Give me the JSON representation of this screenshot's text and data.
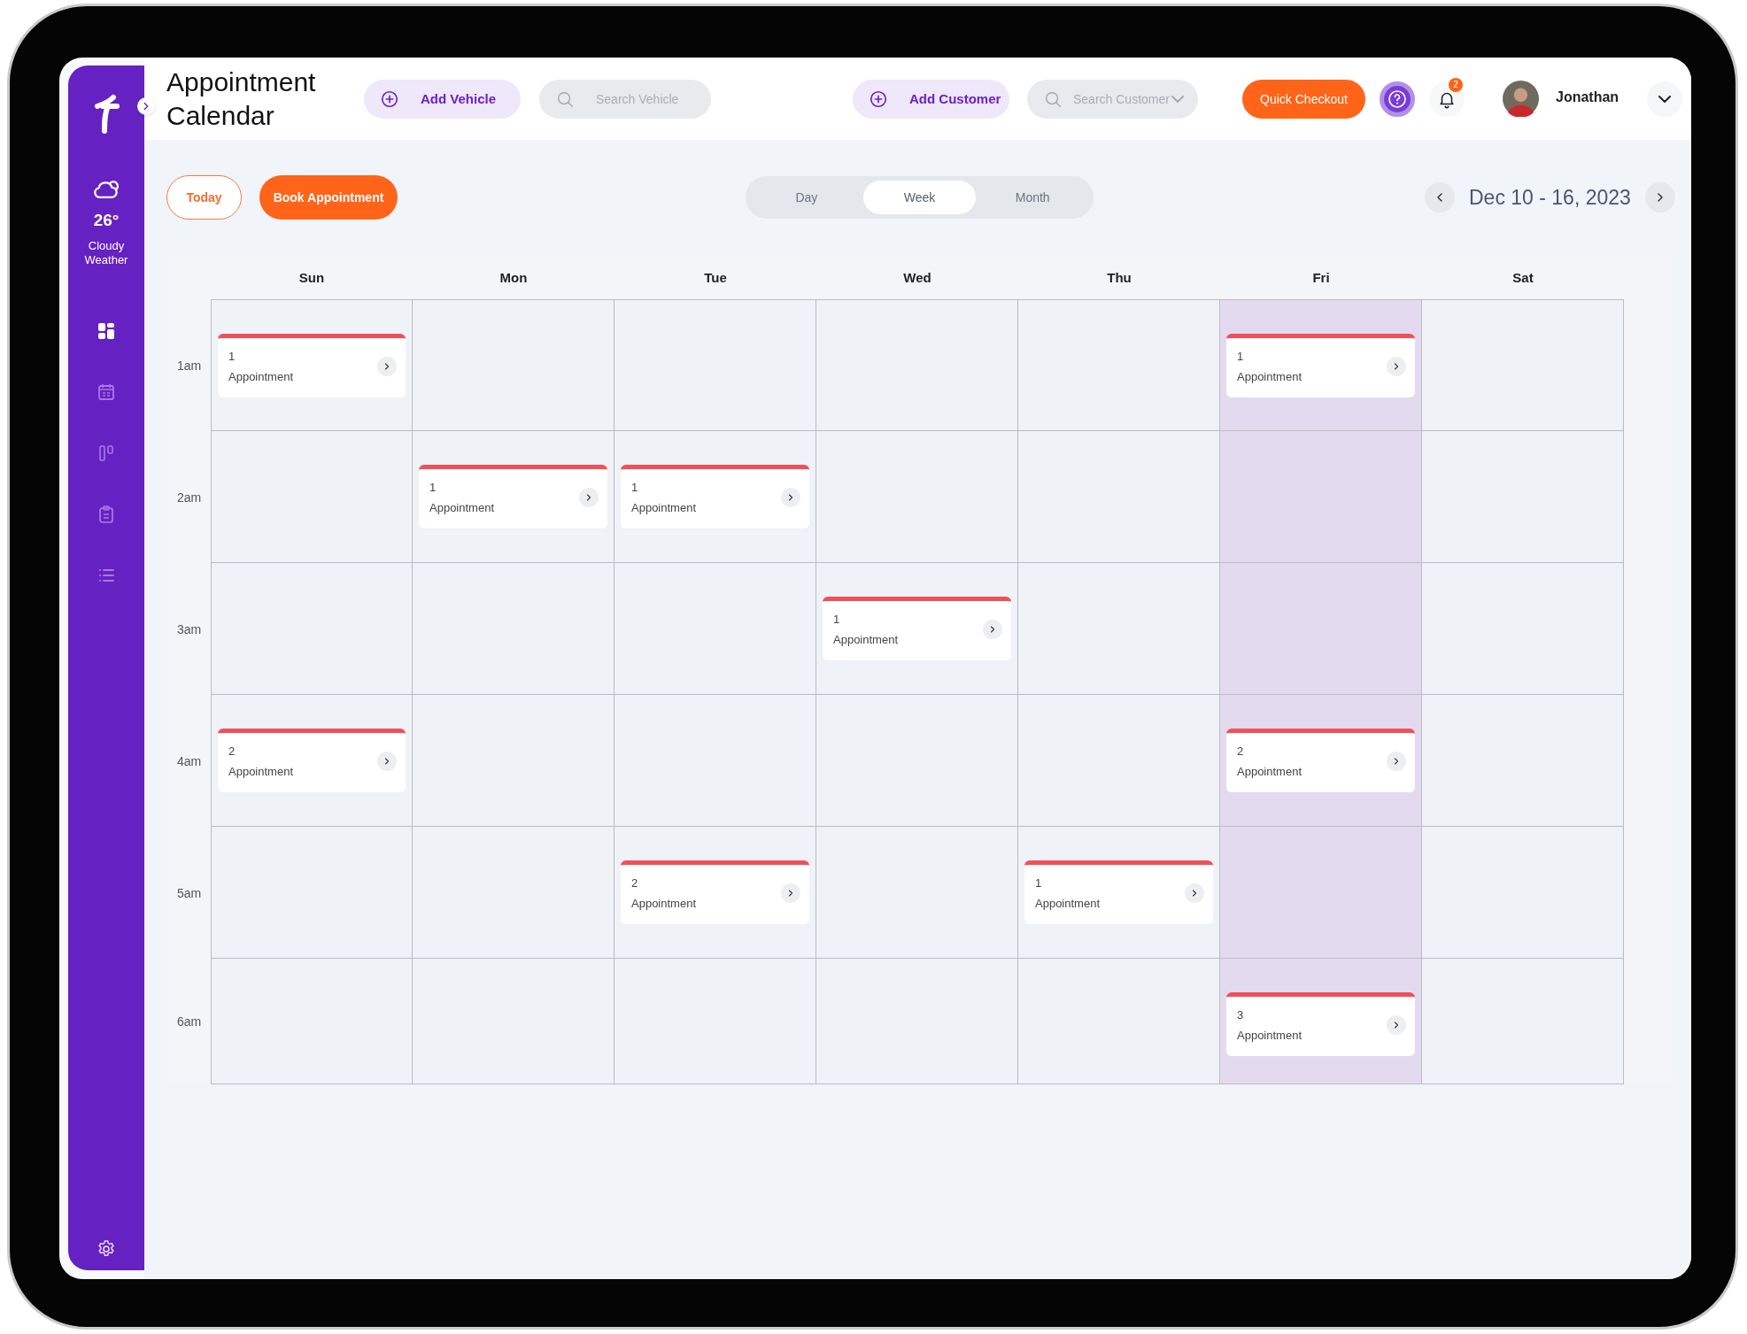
{
  "sidebar": {
    "weather": {
      "temperature": "26°",
      "condition": "Cloudy Weather"
    },
    "nav_items": [
      {
        "kind": "dashboard",
        "selected": true
      },
      {
        "kind": "calendar",
        "selected": false
      },
      {
        "kind": "board",
        "selected": false
      },
      {
        "kind": "clipboard",
        "selected": false
      },
      {
        "kind": "list",
        "selected": false
      }
    ]
  },
  "header": {
    "title": "Appointment Calendar",
    "add_vehicle": {
      "label": "Add Vehicle"
    },
    "search_vehicle": {
      "placeholder": "Search Vehicle"
    },
    "add_customer": {
      "label": "Add Customer"
    },
    "search_customer": {
      "placeholder": "Search Customer"
    },
    "quick_checkout": {
      "label": "Quick Checkout"
    },
    "notifications": {
      "count": "2"
    },
    "user": {
      "name": "Jonathan"
    }
  },
  "toolbar": {
    "today": {
      "label": "Today"
    },
    "book": {
      "label": "Book Appointment"
    },
    "views": [
      {
        "label": "Day",
        "selected": false
      },
      {
        "label": "Week",
        "selected": true
      },
      {
        "label": "Month",
        "selected": false
      }
    ],
    "date_range": "Dec 10 - 16, 2023"
  },
  "calendar": {
    "days": [
      {
        "label": "Sun",
        "selected": false
      },
      {
        "label": "Mon",
        "selected": false
      },
      {
        "label": "Tue",
        "selected": false
      },
      {
        "label": "Wed",
        "selected": false
      },
      {
        "label": "Thu",
        "selected": false
      },
      {
        "label": "Fri",
        "selected": true
      },
      {
        "label": "Sat",
        "selected": false
      }
    ],
    "rows": [
      {
        "time": "1am",
        "cells": [
          {
            "count": "1",
            "label": "Appointment"
          },
          null,
          null,
          null,
          null,
          {
            "count": "1",
            "label": "Appointment"
          },
          null
        ]
      },
      {
        "time": "2am",
        "cells": [
          null,
          {
            "count": "1",
            "label": "Appointment"
          },
          {
            "count": "1",
            "label": "Appointment"
          },
          null,
          null,
          null,
          null
        ]
      },
      {
        "time": "3am",
        "cells": [
          null,
          null,
          null,
          {
            "count": "1",
            "label": "Appointment"
          },
          null,
          null,
          null
        ]
      },
      {
        "time": "4am",
        "cells": [
          {
            "count": "2",
            "label": "Appointment"
          },
          null,
          null,
          null,
          null,
          {
            "count": "2",
            "label": "Appointment"
          },
          null
        ]
      },
      {
        "time": "5am",
        "cells": [
          null,
          null,
          {
            "count": "2",
            "label": "Appointment"
          },
          null,
          {
            "count": "1",
            "label": "Appointment"
          },
          null,
          null
        ]
      },
      {
        "time": "6am",
        "cells": [
          null,
          null,
          null,
          null,
          null,
          {
            "count": "3",
            "label": "Appointment"
          },
          null
        ]
      }
    ]
  }
}
